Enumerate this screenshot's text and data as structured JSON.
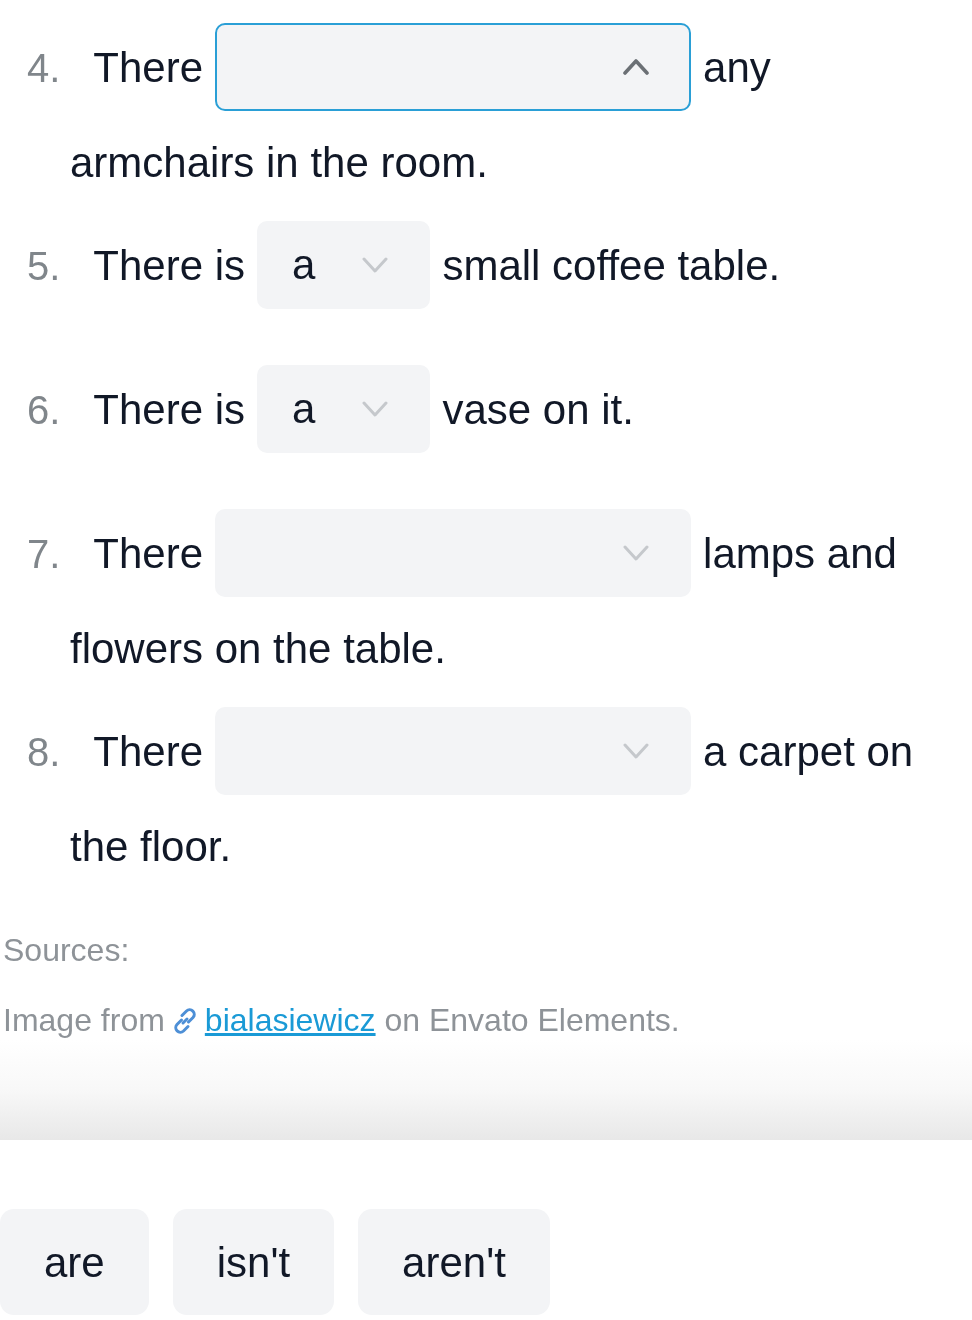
{
  "items": [
    {
      "number": "4.",
      "parts": [
        {
          "kind": "text",
          "text": "There"
        },
        {
          "kind": "select",
          "expanded": true
        },
        {
          "kind": "text",
          "text": "any"
        },
        {
          "kind": "text",
          "text": "armchairs in the room."
        }
      ]
    },
    {
      "number": "5.",
      "parts": [
        {
          "kind": "text",
          "text": "There is"
        },
        {
          "kind": "select",
          "expanded": false,
          "value": "a"
        },
        {
          "kind": "text",
          "text": "small coffee table."
        }
      ]
    },
    {
      "number": "6.",
      "parts": [
        {
          "kind": "text",
          "text": "There is"
        },
        {
          "kind": "select",
          "expanded": false,
          "value": "a"
        },
        {
          "kind": "text",
          "text": "vase on it."
        }
      ]
    },
    {
      "number": "7.",
      "parts": [
        {
          "kind": "text",
          "text": "There"
        },
        {
          "kind": "select",
          "expanded": false
        },
        {
          "kind": "text",
          "text": "lamps and"
        },
        {
          "kind": "text",
          "text": "flowers on the table."
        }
      ]
    },
    {
      "number": "8.",
      "parts": [
        {
          "kind": "text",
          "text": "There"
        },
        {
          "kind": "select",
          "expanded": false
        },
        {
          "kind": "text",
          "text": "a carpet on"
        },
        {
          "kind": "text",
          "text": "the floor."
        }
      ]
    }
  ],
  "sources": {
    "heading": "Sources:",
    "credit": {
      "before": "Image from",
      "link": "bialasiewicz",
      "after": "on Envato Elements."
    }
  },
  "answer_options": [
    {
      "label": "are"
    },
    {
      "label": "isn't"
    },
    {
      "label": "aren't"
    }
  ]
}
